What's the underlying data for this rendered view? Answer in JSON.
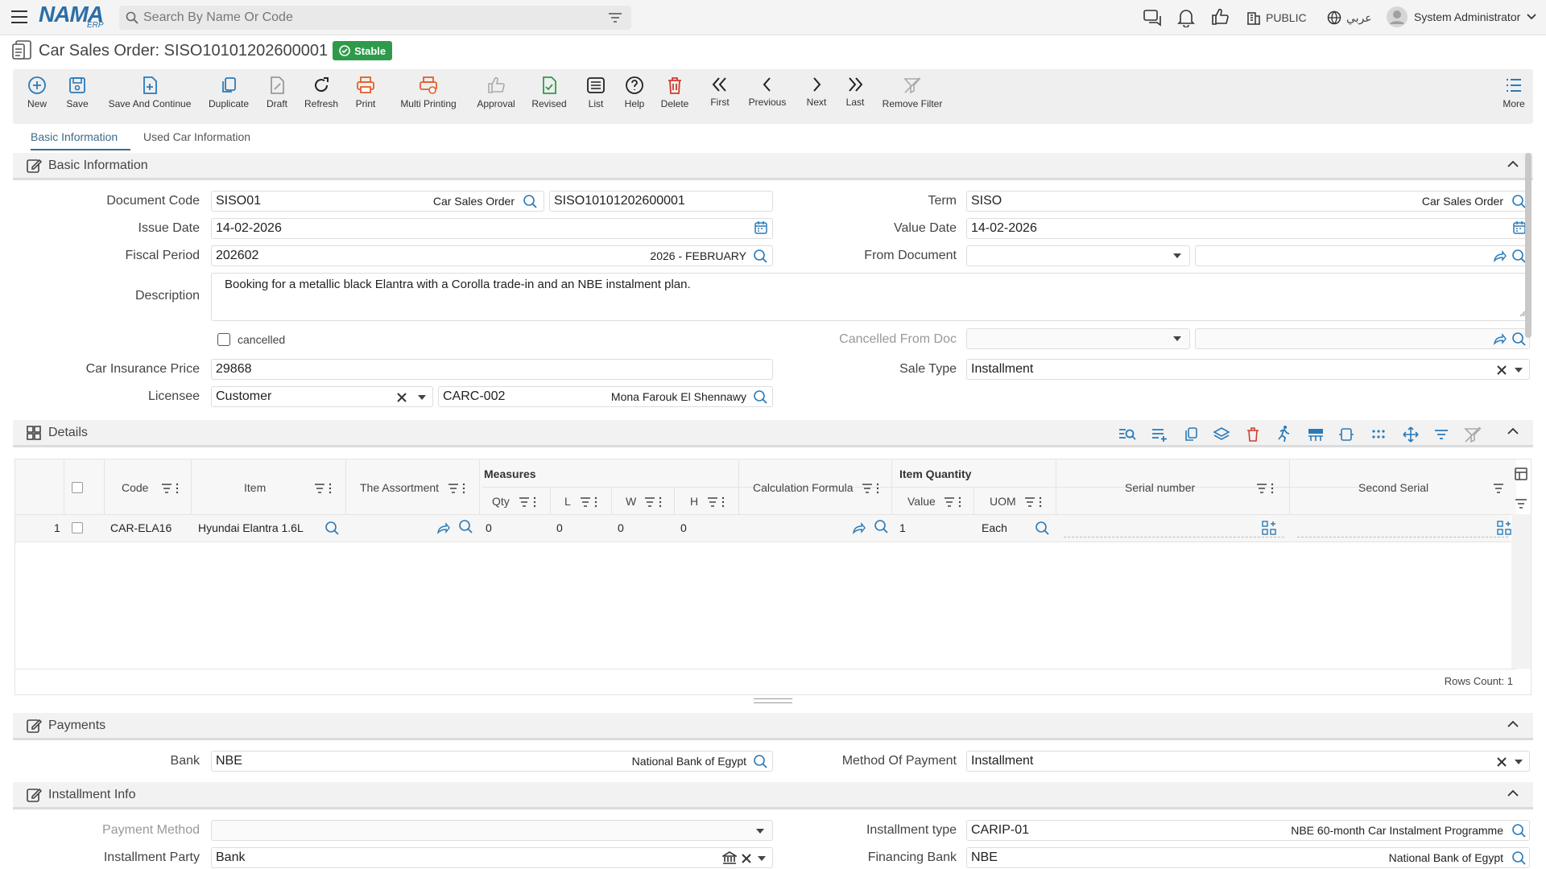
{
  "app": {
    "logo_text": "NAMA",
    "logo_sub": "ERP"
  },
  "search": {
    "placeholder": "Search By Name Or Code"
  },
  "topbar": {
    "public_label": "PUBLIC",
    "language_label": "عربي",
    "user_name": "System Administrator"
  },
  "page": {
    "title": "Car Sales Order: SISO10101202600001",
    "status": "Stable",
    "status_color": "#2e9b4a"
  },
  "toolbar": {
    "new": "New",
    "save": "Save",
    "save_continue": "Save And Continue",
    "duplicate": "Duplicate",
    "draft": "Draft",
    "refresh": "Refresh",
    "print": "Print",
    "multi_printing": "Multi Printing",
    "approval": "Approval",
    "revised": "Revised",
    "list": "List",
    "help": "Help",
    "delete": "Delete",
    "first": "First",
    "previous": "Previous",
    "next": "Next",
    "last": "Last",
    "remove_filter": "Remove Filter",
    "more": "More"
  },
  "tabs": {
    "basic": "Basic Information",
    "used_car": "Used Car Information"
  },
  "basic": {
    "section_title": "Basic Information",
    "document_code_label": "Document Code",
    "document_code": "SISO01",
    "document_code_name": "Car Sales Order",
    "document_number": "SISO10101202600001",
    "term_label": "Term",
    "term": "SISO",
    "term_name": "Car Sales Order",
    "issue_date_label": "Issue Date",
    "issue_date": "14-02-2026",
    "value_date_label": "Value Date",
    "value_date": "14-02-2026",
    "fiscal_period_label": "Fiscal Period",
    "fiscal_period": "202602",
    "fiscal_period_name": "2026 - FEBRUARY",
    "from_document_label": "From Document",
    "description_label": "Description",
    "description": "Booking for a metallic black Elantra with a Corolla trade-in and an NBE instalment plan.",
    "cancelled_label": "cancelled",
    "cancelled_from_doc_label": "Cancelled From Doc",
    "car_insurance_price_label": "Car Insurance Price",
    "car_insurance_price": "29868",
    "sale_type_label": "Sale Type",
    "sale_type": "Installment",
    "licensee_label": "Licensee",
    "licensee_type": "Customer",
    "licensee_code": "CARC-002",
    "licensee_name": "Mona Farouk El Shennawy"
  },
  "details": {
    "section_title": "Details",
    "headers": {
      "code": "Code",
      "item": "Item",
      "assortment": "The Assortment",
      "measures": "Measures",
      "qty": "Qty",
      "l": "L",
      "w": "W",
      "h": "H",
      "calc_formula": "Calculation Formula",
      "item_quantity": "Item Quantity",
      "value": "Value",
      "uom": "UOM",
      "serial": "Serial number",
      "second_serial": "Second Serial"
    },
    "rows": [
      {
        "num": "1",
        "code": "CAR-ELA16",
        "item": "Hyundai Elantra 1.6L",
        "qty": "0",
        "l": "0",
        "w": "0",
        "h": "0",
        "value": "1",
        "uom": "Each"
      }
    ],
    "rows_count": "Rows Count: 1"
  },
  "payments": {
    "section_title": "Payments",
    "bank_label": "Bank",
    "bank": "NBE",
    "bank_name": "National Bank of Egypt",
    "method_label": "Method Of Payment",
    "method": "Installment"
  },
  "installment": {
    "section_title": "Installment Info",
    "payment_method_label": "Payment Method",
    "installment_type_label": "Installment type",
    "installment_type": "CARIP-01",
    "installment_type_name": "NBE 60-month Car Instalment Programme",
    "installment_party_label": "Installment Party",
    "installment_party": "Bank",
    "financing_bank_label": "Financing Bank",
    "financing_bank": "NBE",
    "financing_bank_name": "National Bank of Egypt"
  }
}
